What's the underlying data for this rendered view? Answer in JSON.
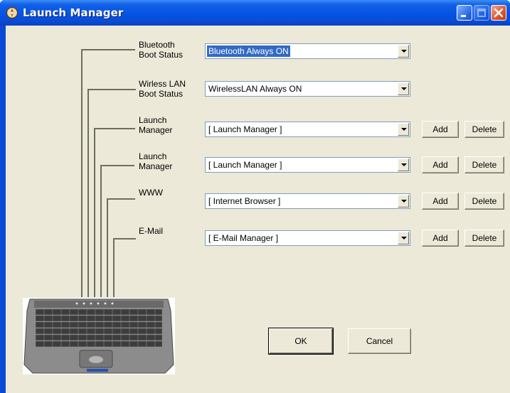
{
  "window": {
    "title": "Launch Manager"
  },
  "rows": [
    {
      "label_line1": "Bluetooth",
      "label_line2": "Boot Status",
      "value": "Bluetooth Always ON",
      "has_buttons": false
    },
    {
      "label_line1": "Wirless LAN",
      "label_line2": "Boot Status",
      "value": "WirelessLAN Always ON",
      "has_buttons": false
    },
    {
      "label_line1": "Launch",
      "label_line2": "Manager",
      "value": "[ Launch Manager ]",
      "has_buttons": true
    },
    {
      "label_line1": "Launch",
      "label_line2": "Manager",
      "value": "[ Launch Manager ]",
      "has_buttons": true
    },
    {
      "label_line1": "WWW",
      "label_line2": "",
      "value": "[ Internet Browser ]",
      "has_buttons": true
    },
    {
      "label_line1": "E-Mail",
      "label_line2": "",
      "value": "[ E-Mail Manager ]",
      "has_buttons": true
    }
  ],
  "buttons": {
    "add": "Add",
    "delete": "Delete",
    "ok": "OK",
    "cancel": "Cancel"
  },
  "icons": {
    "app": "launch-manager-icon",
    "minimize": "minimize-icon",
    "maximize": "maximize-icon",
    "close": "close-icon",
    "dropdown": "chevron-down-icon"
  },
  "colors": {
    "titlebar": "#0554e3",
    "client": "#ece9d8",
    "selection": "#316ac5"
  }
}
